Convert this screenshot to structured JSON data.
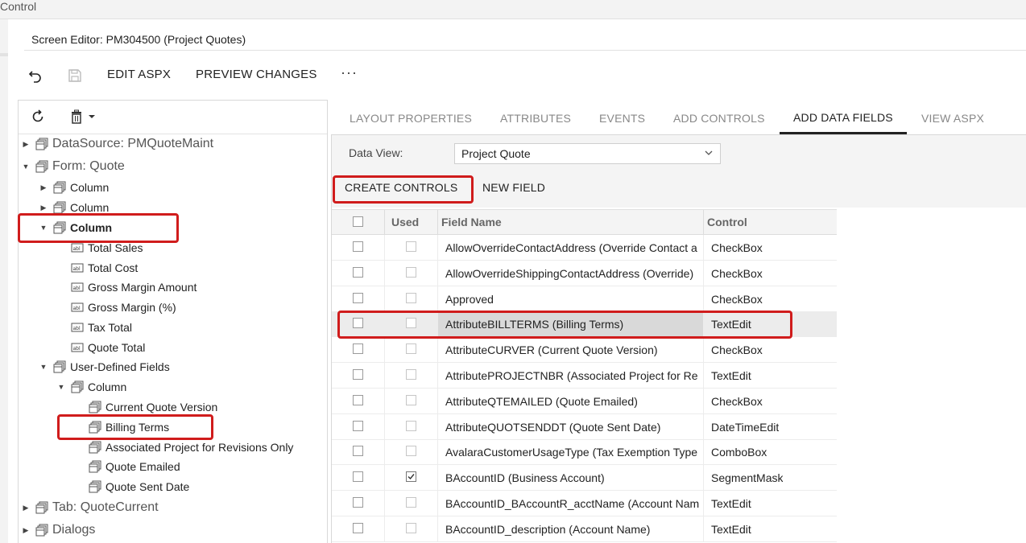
{
  "window": {
    "title_fragment": "Control"
  },
  "screen_title": "Screen Editor: PM304500 (Project Quotes)",
  "toolbar": {
    "undo_icon": "undo-icon",
    "save_icon": "save-icon",
    "edit_aspx": "EDIT ASPX",
    "preview_changes": "PREVIEW CHANGES",
    "more": "···"
  },
  "tree": {
    "toolbar": {
      "refresh_icon": "refresh-icon",
      "delete_icon": "trash-icon"
    },
    "nodes": [
      {
        "label": "DataSource: PMQuoteMaint"
      },
      {
        "label": "Form: Quote"
      },
      {
        "label": "Column"
      },
      {
        "label": "Column"
      },
      {
        "label": "Column"
      },
      {
        "label": "Total Sales"
      },
      {
        "label": "Total Cost"
      },
      {
        "label": "Gross Margin Amount"
      },
      {
        "label": "Gross Margin (%)"
      },
      {
        "label": "Tax Total"
      },
      {
        "label": "Quote Total"
      },
      {
        "label": "User-Defined Fields"
      },
      {
        "label": "Column"
      },
      {
        "label": "Current Quote Version"
      },
      {
        "label": "Billing Terms"
      },
      {
        "label": "Associated Project for Revisions Only"
      },
      {
        "label": "Quote Emailed"
      },
      {
        "label": "Quote Sent Date"
      },
      {
        "label": "Tab: QuoteCurrent"
      },
      {
        "label": "Dialogs"
      }
    ]
  },
  "tabs": [
    {
      "label": "LAYOUT PROPERTIES",
      "active": false
    },
    {
      "label": "ATTRIBUTES",
      "active": false
    },
    {
      "label": "EVENTS",
      "active": false
    },
    {
      "label": "ADD CONTROLS",
      "active": false
    },
    {
      "label": "ADD DATA FIELDS",
      "active": true
    },
    {
      "label": "VIEW ASPX",
      "active": false
    }
  ],
  "data_view": {
    "label": "Data View:",
    "value": "Project Quote"
  },
  "actions": {
    "create_controls": "CREATE CONTROLS",
    "new_field": "NEW FIELD"
  },
  "grid": {
    "headers": {
      "used": "Used",
      "field_name": "Field Name",
      "control": "Control"
    },
    "rows": [
      {
        "field": "AllowOverrideContactAddress (Override Contact a",
        "control": "CheckBox",
        "used": false
      },
      {
        "field": "AllowOverrideShippingContactAddress (Override)",
        "control": "CheckBox",
        "used": false
      },
      {
        "field": "Approved",
        "control": "CheckBox",
        "used": false
      },
      {
        "field": "AttributeBILLTERMS (Billing Terms)",
        "control": "TextEdit",
        "used": false,
        "selected": true
      },
      {
        "field": "AttributeCURVER (Current Quote Version)",
        "control": "CheckBox",
        "used": false
      },
      {
        "field": "AttributePROJECTNBR (Associated Project for Re",
        "control": "TextEdit",
        "used": false
      },
      {
        "field": "AttributeQTEMAILED (Quote Emailed)",
        "control": "CheckBox",
        "used": false
      },
      {
        "field": "AttributeQUOTSENDDT (Quote Sent Date)",
        "control": "DateTimeEdit",
        "used": false
      },
      {
        "field": "AvalaraCustomerUsageType (Tax Exemption Type",
        "control": "ComboBox",
        "used": false
      },
      {
        "field": "BAccountID (Business Account)",
        "control": "SegmentMask",
        "used": true
      },
      {
        "field": "BAccountID_BAccountR_acctName (Account Nam",
        "control": "TextEdit",
        "used": false
      },
      {
        "field": "BAccountID_description (Account Name)",
        "control": "TextEdit",
        "used": false
      }
    ]
  },
  "colors": {
    "highlight": "#d01c1c",
    "active_tab_underline": "#222222"
  }
}
